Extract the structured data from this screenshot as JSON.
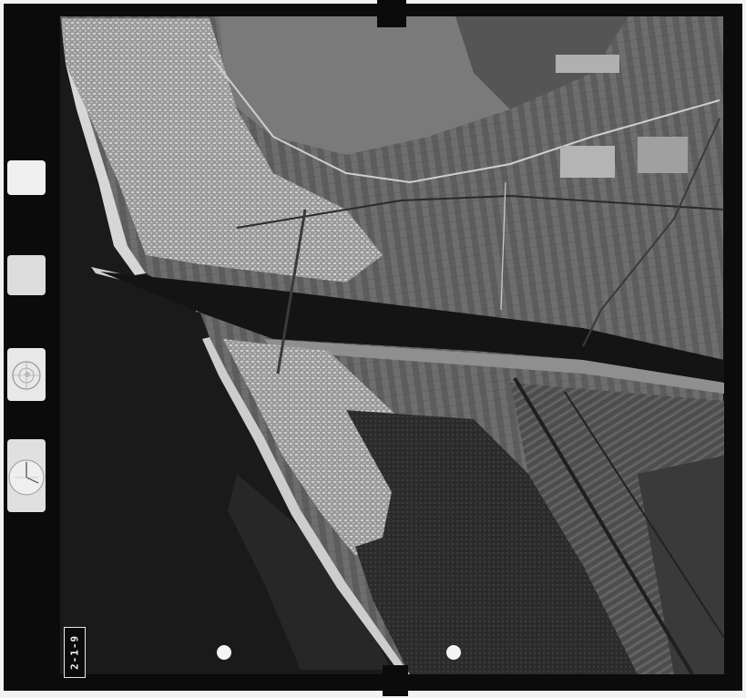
{
  "photo": {
    "frame_label": "2-1-9",
    "counter_text": "",
    "colors": {
      "sea": "#1a1a1a",
      "sea_light": "#2e2e2e",
      "land_urban": "#a9a9a9",
      "land_fields": "#6b6b6b",
      "forest": "#2f2f2f",
      "canal": "#141414",
      "film_border": "#0b0b0b",
      "paper": "#f2f2f2"
    }
  }
}
